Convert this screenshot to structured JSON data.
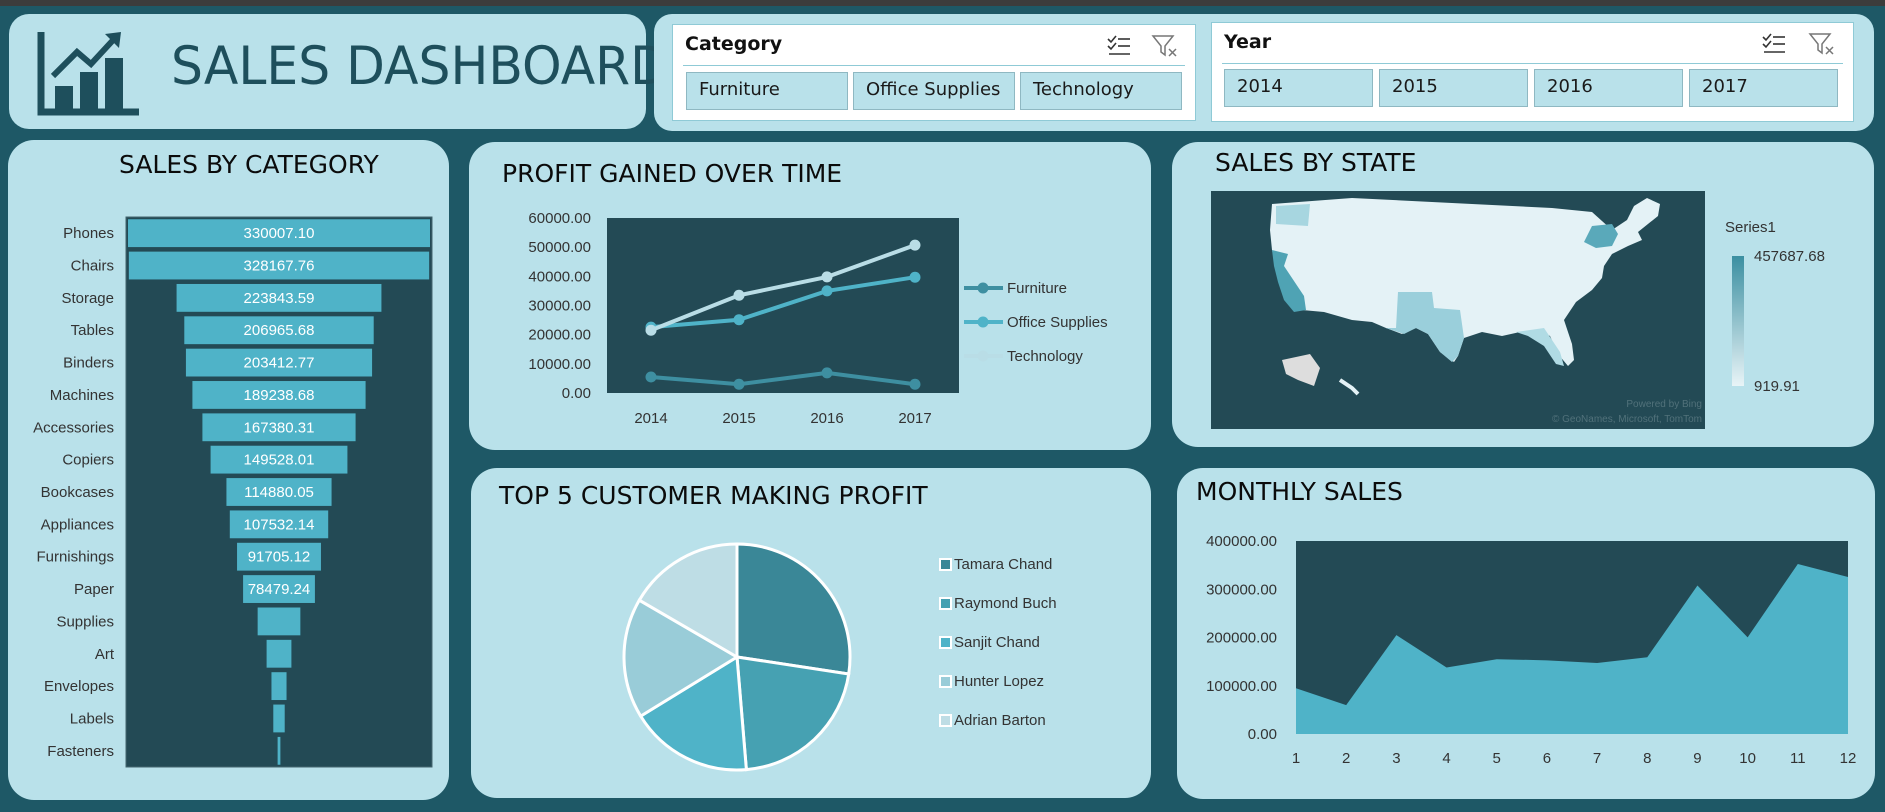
{
  "header": {
    "title": "SALES DASHBOARD",
    "logo_icon": "bar-chart-growth-icon"
  },
  "slicers": [
    {
      "title": "Category",
      "options": [
        "Furniture",
        "Office Supplies",
        "Technology"
      ],
      "icons": [
        "multi-select-icon",
        "clear-filter-icon"
      ]
    },
    {
      "title": "Year",
      "options": [
        "2014",
        "2015",
        "2016",
        "2017"
      ],
      "icons": [
        "multi-select-icon",
        "clear-filter-icon"
      ]
    }
  ],
  "colors": {
    "background": "#1e5866",
    "panel": "#b9e1ea",
    "plot": "#234a55",
    "bar": "#4fb3c8",
    "furniture": "#3e8fa1",
    "office_supplies": "#4fb3c8",
    "technology": "#b9dde6"
  },
  "panels": {
    "sales_by_category": "SALES BY CATEGORY",
    "profit_over_time": "PROFIT GAINED OVER TIME",
    "sales_by_state": "SALES BY STATE",
    "top5": "TOP 5 CUSTOMER MAKING PROFIT",
    "monthly": "MONTHLY SALES"
  },
  "chart_data": [
    {
      "type": "bar",
      "title": "SALES BY CATEGORY",
      "orientation": "horizontal funnel",
      "categories": [
        "Phones",
        "Chairs",
        "Storage",
        "Tables",
        "Binders",
        "Machines",
        "Accessories",
        "Copiers",
        "Bookcases",
        "Appliances",
        "Furnishings",
        "Paper",
        "Supplies",
        "Art",
        "Envelopes",
        "Labels",
        "Fasteners"
      ],
      "values": [
        330007.1,
        328167.76,
        223843.59,
        206965.68,
        203412.77,
        189238.68,
        167380.31,
        149528.01,
        114880.05,
        107532.14,
        91705.12,
        78479.24,
        46673.54,
        27118.79,
        16476.4,
        12486.31,
        3024.28
      ],
      "labels": [
        "330007.10",
        "328167.76",
        "223843.59",
        "206965.68",
        "203412.77",
        "189238.68",
        "167380.31",
        "149528.01",
        "114880.05",
        "107532.14",
        "91705.12",
        "78479.24",
        "",
        "",
        "",
        "",
        ""
      ]
    },
    {
      "type": "line",
      "title": "PROFIT GAINED OVER TIME",
      "categories": [
        "2014",
        "2015",
        "2016",
        "2017"
      ],
      "series": [
        {
          "name": "Furniture",
          "values": [
            5500,
            3000,
            6900,
            3000
          ]
        },
        {
          "name": "Office Supplies",
          "values": [
            22600,
            25100,
            35000,
            39700
          ]
        },
        {
          "name": "Technology",
          "values": [
            21500,
            33500,
            39800,
            50700
          ]
        }
      ],
      "yticks": [
        "60000.00",
        "50000.00",
        "40000.00",
        "30000.00",
        "20000.00",
        "10000.00",
        "0.00"
      ],
      "ylim": [
        0,
        60000
      ],
      "legend": "right"
    },
    {
      "type": "heatmap",
      "title": "SALES BY STATE",
      "legend_title": "Series1",
      "max_label": "457687.68",
      "min_label": "919.91",
      "attribution": [
        "Powered by Bing",
        "© GeoNames, Microsoft, TomTom"
      ]
    },
    {
      "type": "pie",
      "title": "TOP 5 CUSTOMER MAKING PROFIT",
      "labels": [
        "Tamara Chand",
        "Raymond Buch",
        "Sanjit Chand",
        "Hunter Lopez",
        "Adrian Barton"
      ],
      "values": [
        8981.32,
        6976.1,
        5757.41,
        5622.43,
        5444.81
      ],
      "legend": "right"
    },
    {
      "type": "area",
      "title": "MONTHLY SALES",
      "categories": [
        "1",
        "2",
        "3",
        "4",
        "5",
        "6",
        "7",
        "8",
        "9",
        "10",
        "11",
        "12"
      ],
      "values": [
        94925,
        59751,
        205005,
        137762,
        155028,
        152718,
        147238,
        159044,
        307650,
        200323,
        352461,
        325293
      ],
      "yticks": [
        "400000.00",
        "300000.00",
        "200000.00",
        "100000.00",
        "0.00"
      ],
      "ylim": [
        0,
        400000
      ]
    }
  ]
}
